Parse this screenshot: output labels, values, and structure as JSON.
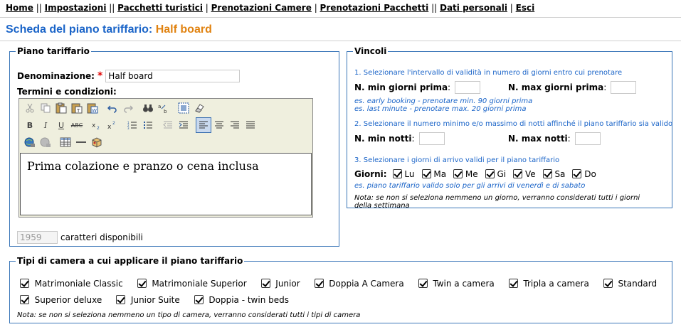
{
  "nav": {
    "home": "Home",
    "impostazioni": "Impostazioni",
    "pacchetti": "Pacchetti turistici",
    "prenotazioni_camere": "Prenotazioni Camere",
    "prenotazioni_pacchetti": "Prenotazioni Pacchetti",
    "dati_personali": "Dati personali",
    "esci": "Esci",
    "sep_single": " | ",
    "sep_double": " || "
  },
  "header": {
    "title": "Scheda del piano tariffario:",
    "plan_name": "Half board"
  },
  "piano": {
    "legend": "Piano tariffario",
    "denominazione_label": "Denominazione:",
    "required_mark": "*",
    "denominazione_value": "Half board",
    "termini_label": "Termini e condizioni:",
    "editor_text": "Prima colazione e pranzo o cena inclusa",
    "chars_value": "1959",
    "chars_label": "caratteri disponibili"
  },
  "vincoli": {
    "legend": "Vincoli",
    "step1": "1. Selezionare l'intervallo di validità in numero di giorni entro cui prenotare",
    "min_giorni_label": "N. min giorni prima",
    "max_giorni_label": "N. max giorni prima",
    "colon": ":",
    "example1a": "es. early booking - prenotare min. 90 giorni prima",
    "example1b": "es. last minute - prenotare max. 20 giorni prima",
    "step2": "2. Selezionare il numero minimo e/o massimo di notti affinché il piano tariffario sia valido",
    "min_notti_label": "N. min notti",
    "max_notti_label": "N. max notti",
    "step3": "3. Selezionare i giorni di arrivo validi per il piano tariffario",
    "giorni_label": "Giorni:",
    "days": [
      "Lu",
      "Ma",
      "Me",
      "Gi",
      "Ve",
      "Sa",
      "Do"
    ],
    "example3": "es. piano tariffario valido solo per gli arrivi di venerdì e di sabato",
    "note3": "Nota: se non si seleziona nemmeno un giorno, verranno considerati tutti i giorni della settimana"
  },
  "camere": {
    "legend": "Tipi di camera a cui applicare il piano tariffario",
    "rooms_row1": [
      "Matrimoniale Classic",
      "Matrimoniale Superior",
      "Junior",
      "Doppia A Camera",
      "Twin a camera",
      "Tripla a camera",
      "Standard"
    ],
    "rooms_row2": [
      "Superior deluxe",
      "Junior Suite",
      "Doppia - twin beds"
    ],
    "note": "Nota: se non si seleziona nemmeno un tipo di camera, verranno considerati tutti i tipi di camera"
  },
  "colors": {
    "title_blue": "#1a64c8",
    "plan_orange": "#e08210",
    "border_blue": "#3a76b8",
    "required_red": "#e00000"
  },
  "toolbar_icons": {
    "row1": [
      "cut-icon",
      "copy-icon",
      "paste-icon",
      "paste-text-icon",
      "paste-word-icon",
      "undo-icon",
      "redo-icon",
      "find-icon",
      "replace-icon",
      "select-all-icon",
      "remove-format-icon"
    ],
    "row2": [
      "bold-icon",
      "italic-icon",
      "underline-icon",
      "strikethrough-icon",
      "subscript-icon",
      "superscript-icon",
      "ordered-list-icon",
      "unordered-list-icon",
      "outdent-icon",
      "indent-icon",
      "align-left-icon",
      "align-center-icon",
      "align-right-icon",
      "justify-icon"
    ],
    "row3": [
      "link-icon",
      "unlink-icon",
      "table-icon",
      "horizontal-rule-icon",
      "special-char-icon"
    ]
  }
}
